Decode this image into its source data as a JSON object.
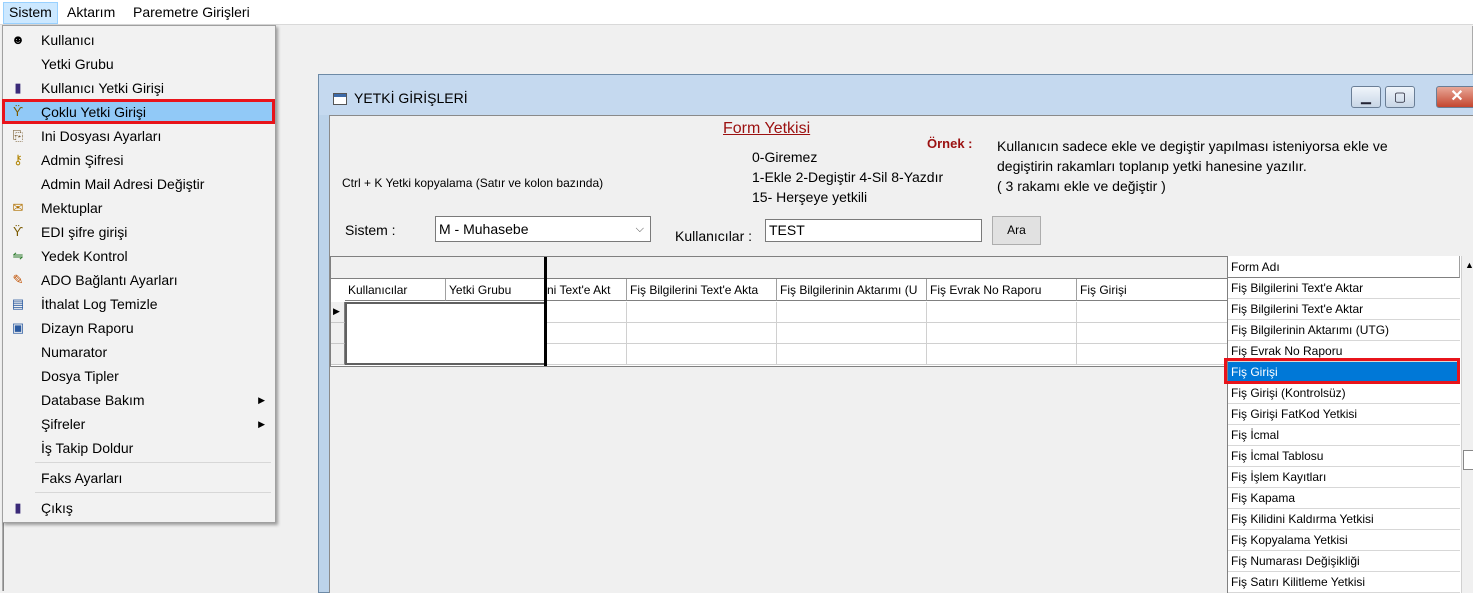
{
  "menubar": {
    "items": [
      "Sistem",
      "Aktarım",
      "Paremetre Girişleri"
    ]
  },
  "menu": {
    "items": [
      {
        "label": "Kullanıcı",
        "icon": "user-icon",
        "glyph": "☻"
      },
      {
        "label": "Yetki Grubu",
        "icon": "",
        "glyph": ""
      },
      {
        "label": "Kullanıcı Yetki Girişi",
        "icon": "book-icon",
        "glyph": "▮"
      },
      {
        "label": "Çoklu Yetki Girişi",
        "icon": "multi-auth-icon",
        "glyph": "ϔ"
      },
      {
        "label": "Ini Dosyası  Ayarları",
        "icon": "file-settings-icon",
        "glyph": "⎘"
      },
      {
        "label": "Admin Şifresi",
        "icon": "key-icon",
        "glyph": "⚷"
      },
      {
        "label": "Admin Mail Adresi Değiştir",
        "icon": "",
        "glyph": ""
      },
      {
        "label": "Mektuplar",
        "icon": "letter-icon",
        "glyph": "✉"
      },
      {
        "label": "EDI şifre girişi",
        "icon": "edi-key-icon",
        "glyph": "ϔ"
      },
      {
        "label": "Yedek Kontrol",
        "icon": "backup-icon",
        "glyph": "⇋"
      },
      {
        "label": "ADO Bağlantı Ayarları",
        "icon": "connection-icon",
        "glyph": "✎"
      },
      {
        "label": "İthalat Log Temizle",
        "icon": "log-clean-icon",
        "glyph": "▤"
      },
      {
        "label": "Dizayn Raporu",
        "icon": "report-design-icon",
        "glyph": "▣"
      },
      {
        "label": "Numarator",
        "icon": "",
        "glyph": ""
      },
      {
        "label": "Dosya Tipler",
        "icon": "",
        "glyph": ""
      },
      {
        "label": "Database Bakım",
        "icon": "",
        "glyph": "",
        "submenu": true
      },
      {
        "label": "Şifreler",
        "icon": "",
        "glyph": "",
        "submenu": true
      },
      {
        "label": "İş Takip Doldur",
        "icon": "",
        "glyph": ""
      },
      {
        "label": "Faks Ayarları",
        "icon": "",
        "glyph": ""
      },
      {
        "label": "Çıkış",
        "icon": "exit-icon",
        "glyph": "▮"
      }
    ]
  },
  "window": {
    "title": "YETKİ GİRİŞLERİ",
    "form_title": "Form Yetkisi",
    "ornek_label": "Örnek :",
    "codes": [
      "0-Giremez",
      "1-Ekle  2-Degiştir  4-Sil  8-Yazdır",
      "15- Herşeye yetkili"
    ],
    "explain": [
      "Kullanıcın sadece ekle ve degiştir yapılması isteniyorsa  ekle ve",
      "degiştirin rakamları toplanıp yetki hanesine yazılır.",
      " ( 3 rakamı ekle ve değiştir )"
    ],
    "ctrl_hint": "Ctrl + K Yetki kopyalama (Satır ve kolon bazında)",
    "sistem_label": "Sistem :",
    "sistem_value": "M - Muhasebe",
    "kullanicilar_label": "Kullanıcılar :",
    "kullanicilar_value": "TEST",
    "ara_label": "Ara"
  },
  "grid": {
    "columns": [
      "Kullanıcılar",
      "Yetki Grubu",
      "ni  Text'e Akt",
      "Fiş Bilgilerini Text'e Akta",
      "Fiş Bilgilerinin Aktarımı (U",
      "Fiş Evrak No Raporu",
      "Fiş Girişi"
    ]
  },
  "formlist": {
    "header": "Form Adı",
    "items": [
      "Fiş Bilgilerini  Text'e Aktar",
      "Fiş Bilgilerini Text'e Aktar",
      "Fiş Bilgilerinin Aktarımı (UTG)",
      "Fiş Evrak No Raporu",
      "Fiş Girişi",
      "Fiş Girişi (Kontrolsüz)",
      "Fiş Girişi FatKod Yetkisi",
      "Fiş İcmal",
      "Fiş İcmal Tablosu",
      "Fiş İşlem Kayıtları",
      "Fiş Kapama",
      "Fiş Kilidini Kaldırma Yetkisi",
      "Fiş Kopyalama Yetkisi",
      "Fiş Numarası Değişikliği",
      "Fiş Satırı Kilitleme Yetkisi"
    ],
    "selected_index": 4
  }
}
